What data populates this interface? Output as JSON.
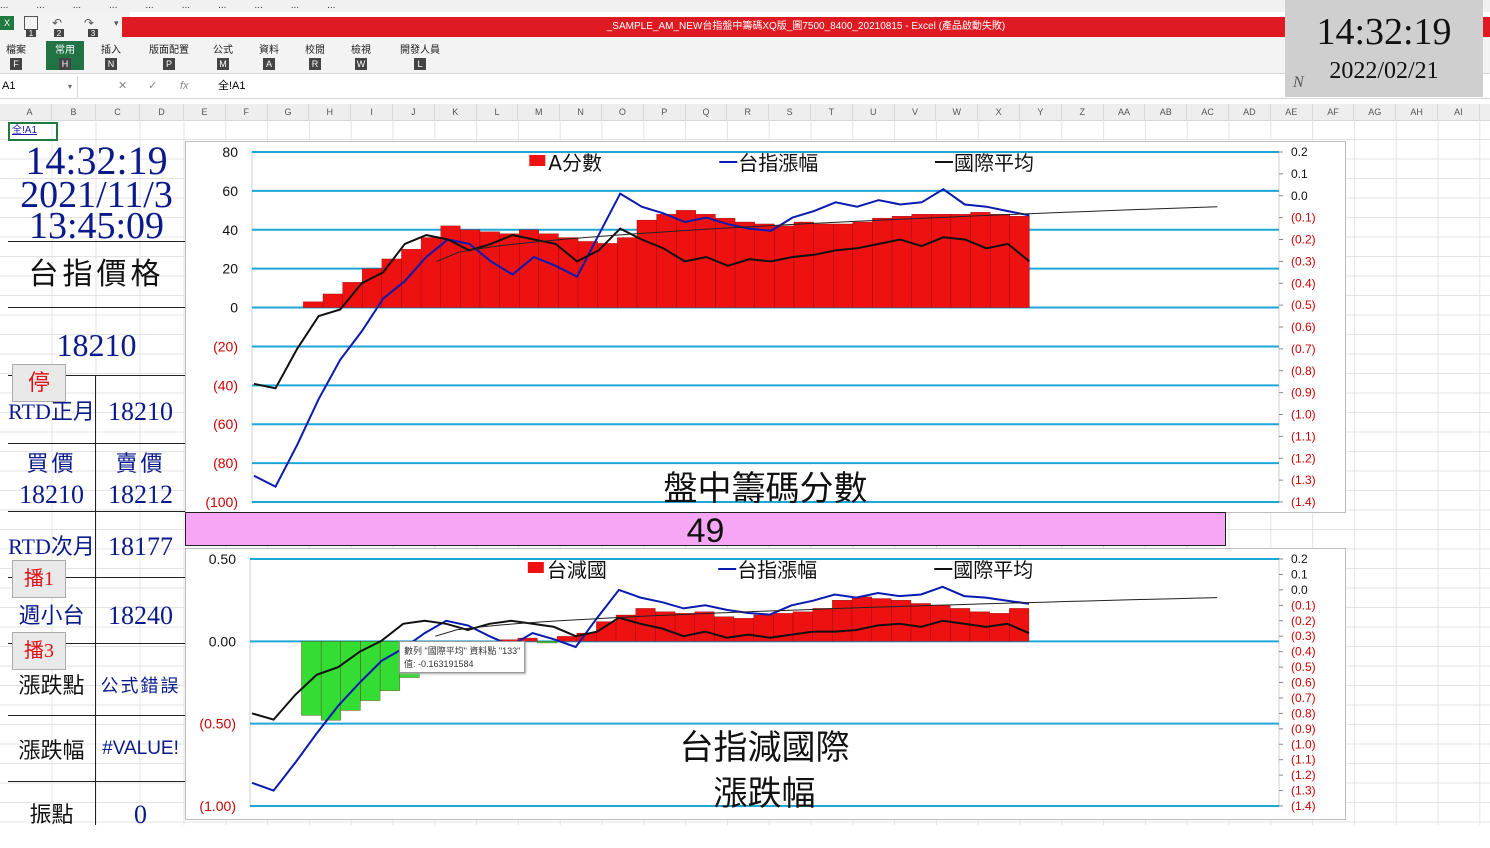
{
  "bookmarks": [
    "...",
    "...",
    "...",
    "...",
    "...",
    "...",
    "...",
    "...",
    "...",
    "..."
  ],
  "ribbon": {
    "file_icon": "excel-icon",
    "title": "_SAMPLE_AM_NEW台指盤中籌碼XQ版_圖7500_8400_20210815 - Excel (產品啟動失敗)",
    "tabs": [
      {
        "label": "檔案",
        "key": "F"
      },
      {
        "label": "常用",
        "key": "H"
      },
      {
        "label": "插入",
        "key": "N"
      },
      {
        "label": "版面配置",
        "key": "P"
      },
      {
        "label": "公式",
        "key": "M"
      },
      {
        "label": "資料",
        "key": "A"
      },
      {
        "label": "校閱",
        "key": "R"
      },
      {
        "label": "檢視",
        "key": "W"
      },
      {
        "label": "開發人員",
        "key": "L"
      }
    ],
    "qat_keys": [
      "1",
      "2",
      "3"
    ]
  },
  "formula_bar": {
    "name_box": "A1",
    "cancel_icon": "✕",
    "enter_icon": "✓",
    "fx": "fx",
    "formula": "全!A1"
  },
  "columns": [
    "A",
    "B",
    "C",
    "D",
    "E",
    "F",
    "G",
    "H",
    "I",
    "J",
    "K",
    "L",
    "M",
    "N",
    "O",
    "P",
    "Q",
    "R",
    "S",
    "T",
    "U",
    "V",
    "W",
    "X",
    "Y",
    "Z",
    "AA",
    "AB",
    "AC",
    "AD",
    "AE",
    "AF",
    "AG",
    "AH",
    "AI"
  ],
  "clock": {
    "time": "14:32:19",
    "date": "2022/02/21",
    "mark": "N"
  },
  "left_panel": {
    "a1_text": "全!A1",
    "time1": "14:32:19",
    "date": "2021/11/3",
    "time2": "13:45:09",
    "index_price_label": "台指價格",
    "index_price": "18210",
    "stop_button": "停",
    "rtd_near_label": "RTD正月",
    "rtd_near_value": "18210",
    "bid_label": "買價",
    "ask_label": "賣價",
    "bid": "18210",
    "ask": "18212",
    "rtd_next_label": "RTD次月",
    "rtd_next_value": "18177",
    "play1_button": "播1",
    "weekly_label": "週小台",
    "weekly_value": "18240",
    "play3_button": "播3",
    "change_pts_label": "漲跌點",
    "change_pts_value": "公式錯誤",
    "change_pct_label": "漲跌幅",
    "change_pct_value": "#VALUE!",
    "amplitude_label": "振點",
    "amplitude_value": "0"
  },
  "band_value": "49",
  "colors": {
    "bar_red": "#ee1111",
    "bar_green": "#33dd33",
    "index_line": "#0a1ab0",
    "intl_line": "#111111",
    "grid": "#1ea6d6",
    "band": "#f7a6f5"
  },
  "chart_data": [
    {
      "type": "bar",
      "title": "盤中籌碼分數",
      "legend": [
        "A分數",
        "台指漲幅",
        "國際平均"
      ],
      "legend_placement": "top",
      "grid": true,
      "ylim": [
        -100,
        80
      ],
      "yticks": [
        "80",
        "60",
        "40",
        "20",
        "0",
        "(20)",
        "(40)",
        "(60)",
        "(80)",
        "(100)"
      ],
      "y2ticks": [
        "0.2",
        "0.1",
        "0.0",
        "(0.1)",
        "(0.2)",
        "(0.3)",
        "(0.4)",
        "(0.5)",
        "(0.6)",
        "(0.7)",
        "(0.8)",
        "(0.9)",
        "(1.0)",
        "(1.1)",
        "(1.2)",
        "(1.3)",
        "(1.4)"
      ],
      "y2lim": [
        -1.4,
        0.2
      ],
      "bars_x": [
        0.2,
        0.4,
        0.6,
        0.8,
        1.0
      ],
      "series": [
        {
          "name": "A分數",
          "kind": "bar",
          "values": [
            3,
            7,
            13,
            20,
            25,
            30,
            36,
            42,
            40,
            39,
            38,
            40,
            38,
            36,
            34,
            33,
            36,
            45,
            48,
            50,
            48,
            46,
            44,
            43,
            42,
            44,
            43,
            43,
            44,
            46,
            47,
            48,
            48,
            48,
            49,
            48,
            47
          ]
        },
        {
          "name": "台指漲幅",
          "kind": "line2",
          "values": [
            -1.28,
            -1.33,
            -1.14,
            -0.93,
            -0.75,
            -0.62,
            -0.47,
            -0.39,
            -0.28,
            -0.2,
            -0.22,
            -0.3,
            -0.36,
            -0.28,
            -0.32,
            -0.37,
            -0.18,
            0.01,
            -0.05,
            -0.08,
            -0.12,
            -0.1,
            -0.13,
            -0.15,
            -0.16,
            -0.1,
            -0.07,
            -0.03,
            -0.05,
            -0.02,
            -0.04,
            -0.03,
            0.03,
            -0.04,
            -0.05,
            -0.07,
            -0.09
          ]
        },
        {
          "name": "國際平均",
          "kind": "line2",
          "values": [
            -0.86,
            -0.88,
            -0.7,
            -0.55,
            -0.52,
            -0.4,
            -0.35,
            -0.22,
            -0.18,
            -0.2,
            -0.25,
            -0.22,
            -0.18,
            -0.2,
            -0.22,
            -0.3,
            -0.25,
            -0.15,
            -0.2,
            -0.24,
            -0.3,
            -0.28,
            -0.32,
            -0.29,
            -0.3,
            -0.28,
            -0.27,
            -0.25,
            -0.24,
            -0.22,
            -0.2,
            -0.23,
            -0.19,
            -0.2,
            -0.24,
            -0.22,
            -0.3
          ]
        }
      ]
    },
    {
      "type": "bar",
      "title": "台指減國際\n漲跌幅",
      "legend": [
        "台減國",
        "台指漲幅",
        "國際平均"
      ],
      "legend_placement": "top",
      "grid": true,
      "ylim": [
        -1.0,
        0.5
      ],
      "yticks": [
        "0.50",
        "0.00",
        "(0.50)",
        "(1.00)"
      ],
      "y2ticks": [
        "0.2",
        "0.1",
        "0.0",
        "(0.1)",
        "(0.2)",
        "(0.3)",
        "(0.4)",
        "(0.5)",
        "(0.6)",
        "(0.7)",
        "(0.8)",
        "(0.9)",
        "(1.0)",
        "(1.1)",
        "(1.2)",
        "(1.3)",
        "(1.4)"
      ],
      "y2lim": [
        -1.4,
        0.2
      ],
      "series": [
        {
          "name": "台減國",
          "kind": "bar",
          "values": [
            -0.45,
            -0.48,
            -0.42,
            -0.36,
            -0.3,
            -0.22,
            -0.17,
            -0.1,
            -0.05,
            0.0,
            0.01,
            0.02,
            -0.01,
            0.03,
            0.05,
            0.12,
            0.16,
            0.2,
            0.18,
            0.17,
            0.18,
            0.15,
            0.14,
            0.16,
            0.17,
            0.18,
            0.2,
            0.25,
            0.27,
            0.26,
            0.25,
            0.23,
            0.22,
            0.2,
            0.18,
            0.17,
            0.2
          ]
        },
        {
          "name": "台指漲幅",
          "kind": "line2",
          "values": [
            -1.25,
            -1.3,
            -1.12,
            -0.93,
            -0.75,
            -0.6,
            -0.46,
            -0.38,
            -0.28,
            -0.2,
            -0.23,
            -0.3,
            -0.36,
            -0.28,
            -0.32,
            -0.37,
            -0.18,
            0.0,
            -0.05,
            -0.08,
            -0.12,
            -0.1,
            -0.13,
            -0.15,
            -0.16,
            -0.1,
            -0.07,
            -0.03,
            -0.05,
            -0.02,
            -0.04,
            -0.03,
            0.02,
            -0.04,
            -0.05,
            -0.07,
            -0.09
          ]
        },
        {
          "name": "國際平均",
          "kind": "line2",
          "values": [
            -0.8,
            -0.84,
            -0.68,
            -0.55,
            -0.5,
            -0.4,
            -0.33,
            -0.22,
            -0.2,
            -0.22,
            -0.26,
            -0.22,
            -0.2,
            -0.22,
            -0.24,
            -0.3,
            -0.27,
            -0.18,
            -0.22,
            -0.25,
            -0.3,
            -0.27,
            -0.31,
            -0.29,
            -0.31,
            -0.29,
            -0.27,
            -0.27,
            -0.26,
            -0.23,
            -0.22,
            -0.24,
            -0.2,
            -0.22,
            -0.24,
            -0.22,
            -0.28
          ]
        }
      ],
      "tooltip": {
        "line1": "數列 \"國際平均\" 資料點 \"133\"",
        "line2": "值: -0.163191584"
      }
    }
  ]
}
